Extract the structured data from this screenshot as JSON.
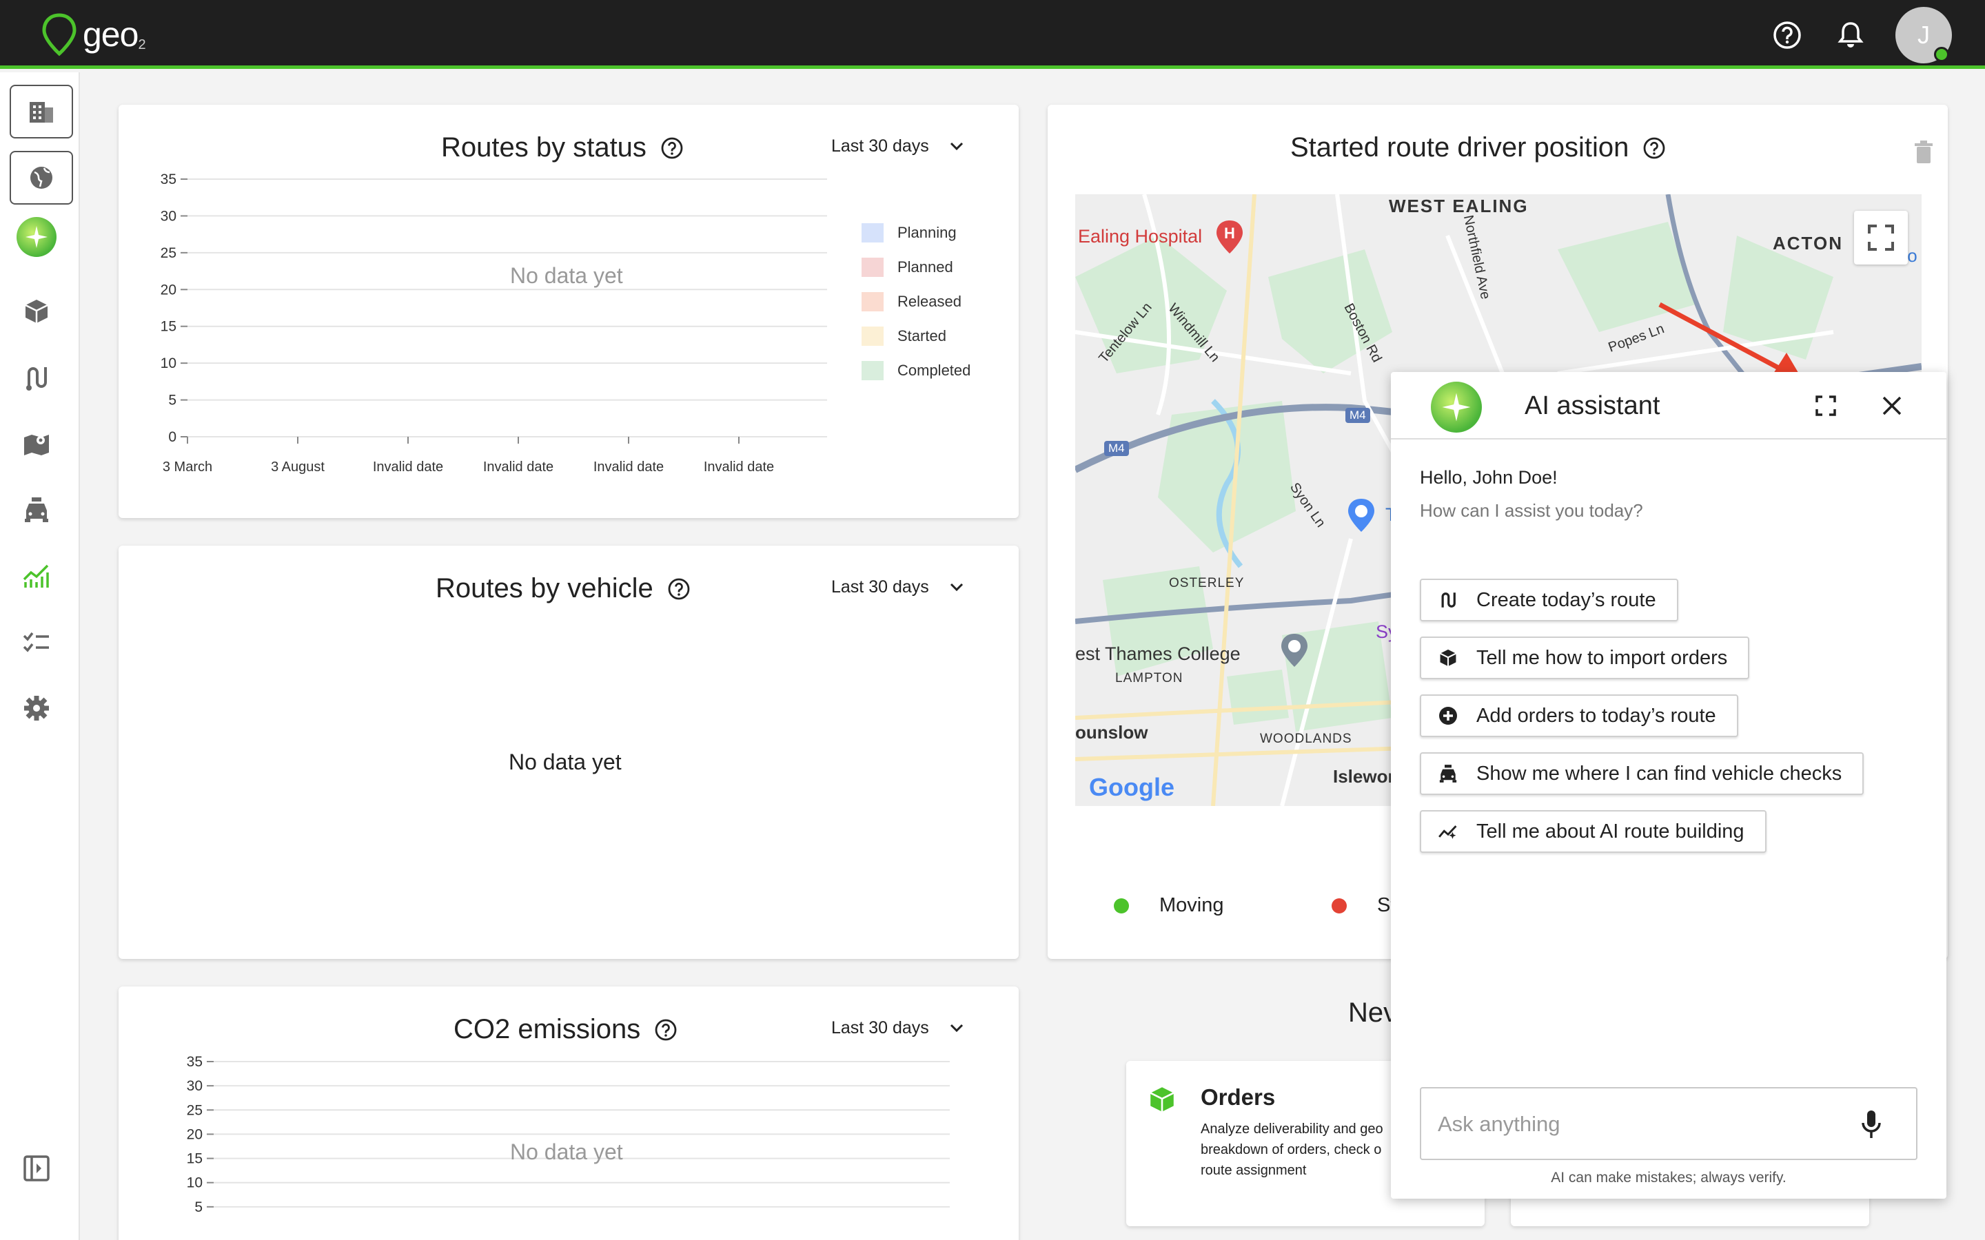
{
  "app": {
    "name": "geo",
    "sub": "2"
  },
  "user": {
    "initial": "J"
  },
  "colors": {
    "accent": "#4cc32b",
    "topbar": "#1f1f1f",
    "arrow": "#e8402a"
  },
  "icons": {
    "help": "help-circle-icon",
    "bell": "bell-icon"
  },
  "sidebar": {
    "items": [
      {
        "name": "sidebar-item-buildings",
        "icon": "building-icon"
      },
      {
        "name": "sidebar-item-globe",
        "icon": "globe-icon"
      },
      {
        "name": "sidebar-item-ai",
        "icon": "ai-sparkle-icon"
      },
      {
        "name": "sidebar-item-orders",
        "icon": "box-icon"
      },
      {
        "name": "sidebar-item-routes",
        "icon": "route-icon"
      },
      {
        "name": "sidebar-item-map",
        "icon": "map-icon"
      },
      {
        "name": "sidebar-item-vehicles",
        "icon": "vehicle-icon"
      },
      {
        "name": "sidebar-item-analytics",
        "icon": "chart-line-icon"
      },
      {
        "name": "sidebar-item-tasks",
        "icon": "checklist-icon"
      },
      {
        "name": "sidebar-item-settings",
        "icon": "gear-icon"
      },
      {
        "name": "sidebar-collapse",
        "icon": "collapse-panel-icon"
      }
    ]
  },
  "routes_by_status": {
    "title": "Routes by status",
    "range": "Last 30 days",
    "empty": "No data yet",
    "legend": [
      "Planning",
      "Planned",
      "Released",
      "Started",
      "Completed"
    ]
  },
  "routes_by_vehicle": {
    "title": "Routes by vehicle",
    "range": "Last 30 days",
    "empty": "No data yet"
  },
  "co2": {
    "title": "CO2 emissions",
    "range": "Last 30 days",
    "empty": "No data yet"
  },
  "driver_position": {
    "title": "Started route driver position",
    "legend_moving": "Moving",
    "legend_stopped": "St"
  },
  "map": {
    "labels": [
      "WEST EALING",
      "ACTON",
      "Ealing Hospital",
      "Tentelow Ln",
      "Windmill Ln",
      "Boston Rd",
      "Northfield Ave",
      "Popes Ln",
      "Syon Ln",
      "OSTERLEY",
      "est Thames College",
      "LAMPTON",
      "ounslow",
      "WOODLANDS",
      "Islewor",
      "M4",
      "Sy",
      "T",
      "to"
    ],
    "brand": "Google"
  },
  "new_section": {
    "heading": "Nev",
    "orders_title": "Orders",
    "orders_desc": [
      "Analyze deliverability and geo",
      "breakdown of orders, check o",
      "route assignment"
    ]
  },
  "ai": {
    "title": "AI assistant",
    "greeting": "Hello, John Doe!",
    "prompt": "How can I assist you today?",
    "suggestions": [
      {
        "label": "Create today’s route",
        "icon": "route-icon"
      },
      {
        "label": "Tell me how to import orders",
        "icon": "box-icon"
      },
      {
        "label": "Add orders to today’s route",
        "icon": "plus-circle-icon"
      },
      {
        "label": "Show me where I can find vehicle checks",
        "icon": "vehicle-icon"
      },
      {
        "label": "Tell me about AI route building",
        "icon": "sparkle-line-icon"
      }
    ],
    "placeholder": "Ask anything",
    "disclaimer": "AI can make mistakes; always verify."
  },
  "chart_data": [
    {
      "type": "bar",
      "title": "Routes by status",
      "categories": [
        "3 March",
        "3 August",
        "Invalid date",
        "Invalid date",
        "Invalid date",
        "Invalid date"
      ],
      "series": [
        {
          "name": "Planning",
          "values": []
        },
        {
          "name": "Planned",
          "values": []
        },
        {
          "name": "Released",
          "values": []
        },
        {
          "name": "Started",
          "values": []
        },
        {
          "name": "Completed",
          "values": []
        }
      ],
      "yticks": [
        "0",
        "5",
        "10",
        "15",
        "20",
        "25",
        "30",
        "35"
      ],
      "ylim": [
        0,
        35
      ],
      "legend_colors": [
        "#d6e2fb",
        "#f6d5d5",
        "#fbdcd0",
        "#fcf0d5",
        "#d9eedd"
      ],
      "legend": "right"
    },
    {
      "type": "bar",
      "title": "CO2 emissions",
      "categories": [],
      "series": [],
      "yticks": [
        "5",
        "10",
        "15",
        "20",
        "25",
        "30",
        "35"
      ],
      "ylim": [
        0,
        35
      ]
    }
  ]
}
